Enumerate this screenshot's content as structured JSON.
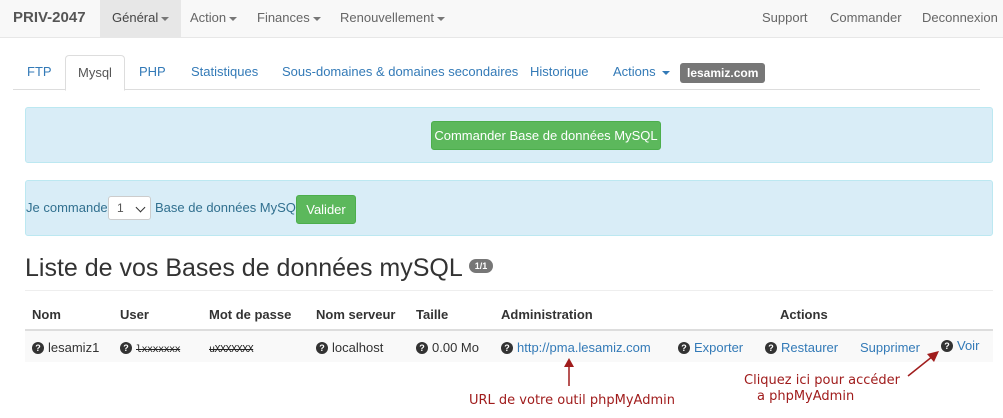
{
  "navbar": {
    "brand": "PRIV-2047",
    "items": [
      {
        "label": "Général",
        "dropdown": true,
        "active": true
      },
      {
        "label": "Action",
        "dropdown": true
      },
      {
        "label": "Finances",
        "dropdown": true
      },
      {
        "label": "Renouvellement",
        "dropdown": true
      }
    ],
    "right_items": [
      "Support",
      "Commander",
      "Deconnexion"
    ]
  },
  "tabs": {
    "items": [
      "FTP",
      "Mysql",
      "PHP",
      "Statistiques",
      "Sous-domaines & domaines secondaires",
      "Historique",
      "Actions"
    ],
    "active": "Mysql",
    "domain_badge": "lesamiz.com"
  },
  "order_box": {
    "button_label": "Commander Base de données MySQL"
  },
  "order_form": {
    "prefix": "Je commande",
    "quantity": "1",
    "suffix": "Base de données MySQL",
    "submit_label": "Valider"
  },
  "title": {
    "text": "Liste de vos Bases de données mySQL",
    "badge": "1/1"
  },
  "table": {
    "headers": {
      "nom": "Nom",
      "user": "User",
      "password": "Mot de passe",
      "server": "Nom serveur",
      "size": "Taille",
      "admin": "Administration",
      "actions": "Actions"
    },
    "row": {
      "nom": "lesamiz1",
      "user": "lxxxxxxx",
      "password": "uXXXXXXX",
      "server": "localhost",
      "size": "0.00 Mo",
      "admin_url": "http://pma.lesamiz.com",
      "export": "Exporter",
      "restore": "Restaurer",
      "delete": "Supprimer",
      "view": "Voir"
    }
  },
  "annotations": {
    "url_note": "URL de votre outil phpMyAdmin",
    "click_note_line1": "Cliquez ici pour accéder",
    "click_note_line2": "a phpMyAdmin"
  },
  "colors": {
    "accent_link": "#337ab7",
    "success": "#5cb85c",
    "info_bg": "#d9edf7",
    "annotation": "#a01c1c"
  }
}
